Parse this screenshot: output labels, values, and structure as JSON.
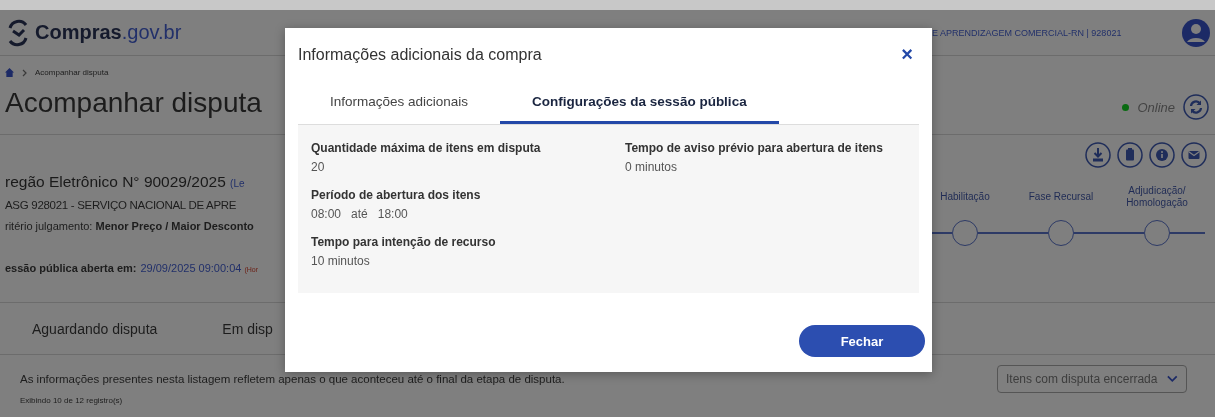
{
  "header": {
    "logo_name": "Compras",
    "logo_domain": ".gov.br",
    "organization": "E APRENDIZAGEM COMERCIAL-RN | 928021"
  },
  "breadcrumb": {
    "current": "Acompanhar disputa"
  },
  "page_title": "Acompanhar disputa",
  "connection": {
    "status": "Online"
  },
  "purchase": {
    "title": "regão Eletrônico N° 90029/2025",
    "title_note": "(Le",
    "uasg": "ASG 928021 - SERVIÇO NACIONAL DE APRE",
    "criterion_label": "ritério julgamento:",
    "criterion_value": "Menor Preço / Maior Desconto",
    "session_label": "essão pública aberta em:",
    "session_value": "29/09/2025 09:00:04",
    "session_note": "(Hor"
  },
  "stages": [
    {
      "label": "Habilitação"
    },
    {
      "label": "Fase Recursal"
    },
    {
      "label": "Adjudicação/ Homologação"
    }
  ],
  "list_tabs": [
    {
      "label": "Aguardando disputa"
    },
    {
      "label": "Em disp"
    }
  ],
  "notice": "As informações presentes nesta listagem refletem apenas o que aconteceu até o final da etapa de disputa.",
  "filter": {
    "value": "Itens com disputa encerrada"
  },
  "record_count": "Exibindo 10 de 12 registro(s)",
  "modal": {
    "title": "Informações adicionais da compra",
    "close": "×",
    "tabs": [
      {
        "label": "Informações adicionais",
        "selected": false
      },
      {
        "label": "Configurações da sessão pública",
        "selected": true
      }
    ],
    "left_fields": [
      {
        "label": "Quantidade máxima de itens em disputa",
        "value": "20"
      },
      {
        "label": "Período de abertura dos itens",
        "value": "08:00   até   18:00"
      },
      {
        "label": "Tempo para intenção de recurso",
        "value": "10 minutos"
      }
    ],
    "right_fields": [
      {
        "label": "Tempo de aviso prévio para abertura de itens",
        "value": "0 minutos"
      }
    ],
    "button": "Fechar"
  }
}
